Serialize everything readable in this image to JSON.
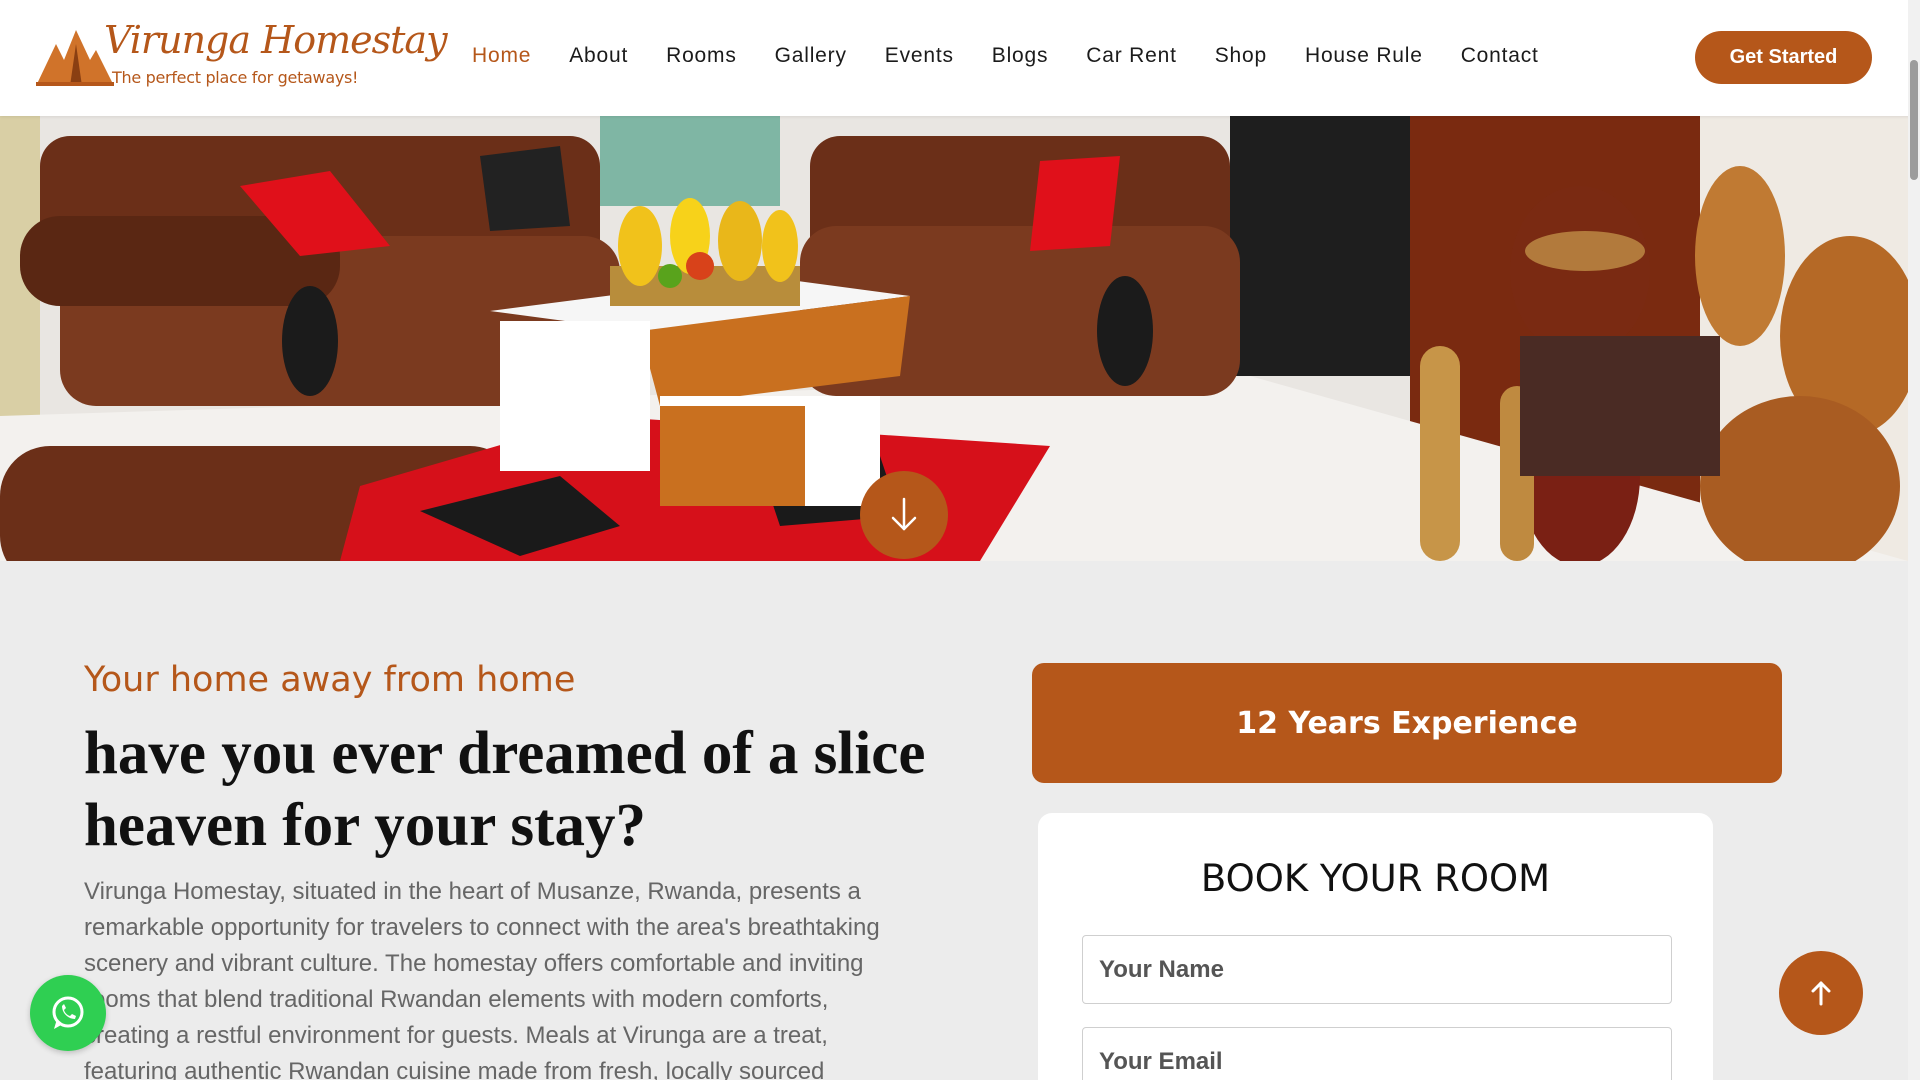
{
  "brand": {
    "name": "Virunga Homestay",
    "tagline": "The perfect place for getaways!",
    "accent_color": "#b5571a",
    "logo_icon": "mountain-logo-icon"
  },
  "nav": {
    "items": [
      {
        "label": "Home",
        "active": true
      },
      {
        "label": "About",
        "active": false
      },
      {
        "label": "Rooms",
        "active": false
      },
      {
        "label": "Gallery",
        "active": false
      },
      {
        "label": "Events",
        "active": false
      },
      {
        "label": "Blogs",
        "active": false
      },
      {
        "label": "Car Rent",
        "active": false
      },
      {
        "label": "Shop",
        "active": false
      },
      {
        "label": "House Rule",
        "active": false
      },
      {
        "label": "Contact",
        "active": false
      }
    ],
    "cta_label": "Get Started"
  },
  "hero": {
    "scroll_icon": "arrow-down-icon"
  },
  "intro": {
    "eyebrow": "Your home away from home",
    "headline": "have you ever dreamed of a slice heaven for your stay?",
    "paragraph": "Virunga Homestay, situated in the heart of Musanze, Rwanda, presents a remarkable opportunity for travelers to connect with the area's breathtaking scenery and vibrant culture. The homestay offers comfortable and inviting rooms that blend traditional Rwandan elements with modern comforts, creating a restful environment for guests. Meals at Virunga are a treat, featuring authentic Rwandan cuisine made from fresh, locally sourced"
  },
  "experience": {
    "label": "12 Years Experience"
  },
  "booking": {
    "title": "BOOK YOUR ROOM",
    "name_placeholder": "Your Name",
    "email_placeholder": "Your Email"
  },
  "floating": {
    "whatsapp_icon": "whatsapp-icon",
    "whatsapp_color": "#2fcf52",
    "top_icon": "arrow-up-icon"
  }
}
